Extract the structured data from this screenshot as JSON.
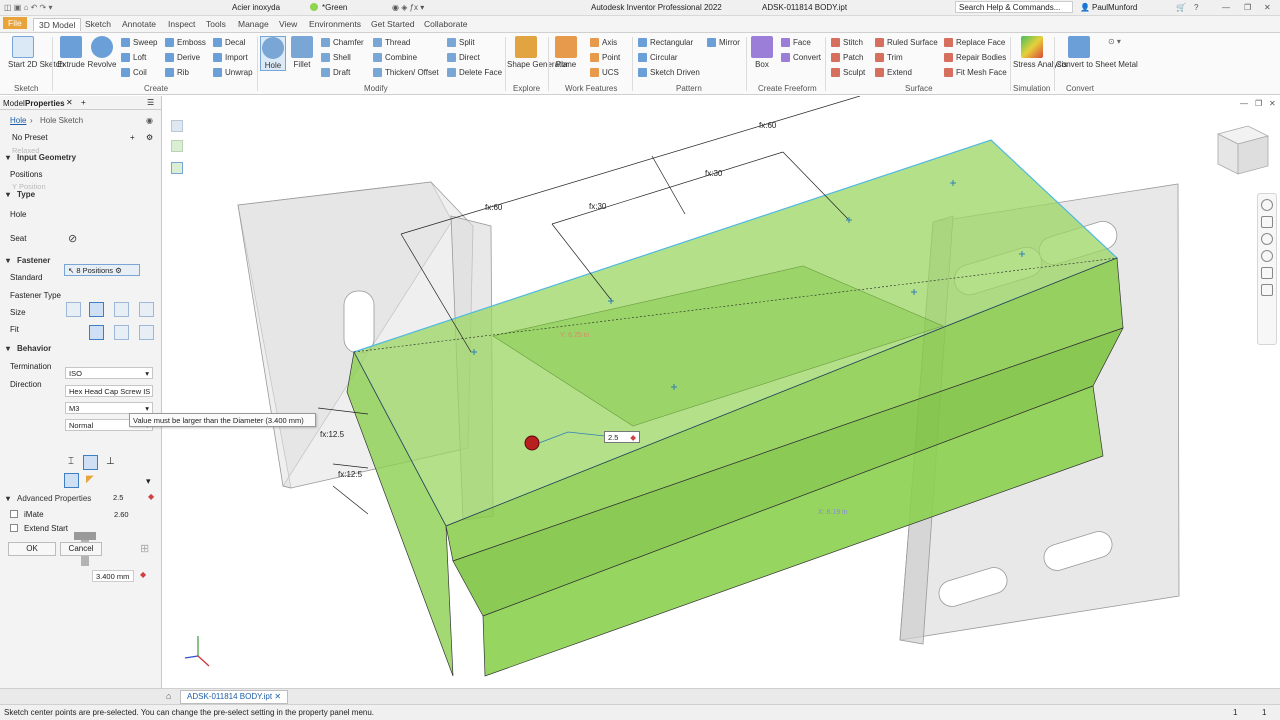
{
  "titlebar": {
    "material": "Acier inoxyda",
    "appearance": "*Green",
    "app_title": "Autodesk Inventor Professional 2022",
    "doc_title": "ADSK-011814 BODY.ipt",
    "search_placeholder": "Search Help & Commands...",
    "user": "PaulMunford"
  },
  "menu_tabs": [
    "File",
    "3D Model",
    "Sketch",
    "Annotate",
    "Inspect",
    "Tools",
    "Manage",
    "View",
    "Environments",
    "Get Started",
    "Collaborate"
  ],
  "ribbon": {
    "start_sketch": "Start 2D Sketch",
    "sketch_group": "Sketch",
    "extrude": "Extrude",
    "revolve": "Revolve",
    "sweep": "Sweep",
    "loft": "Loft",
    "coil": "Coil",
    "emboss": "Emboss",
    "derive": "Derive",
    "rib": "Rib",
    "decal": "Decal",
    "import": "Import",
    "unwrap": "Unwrap",
    "create_group": "Create",
    "hole": "Hole",
    "fillet": "Fillet",
    "chamfer": "Chamfer",
    "shell": "Shell",
    "draft": "Draft",
    "thread": "Thread",
    "combine": "Combine",
    "thicken": "Thicken/ Offset",
    "split": "Split",
    "direct": "Direct",
    "delete_face": "Delete Face",
    "modify_group": "Modify",
    "shape_gen": "Shape Generator",
    "explore_group": "Explore",
    "plane": "Plane",
    "axis": "Axis",
    "point": "Point",
    "ucs": "UCS",
    "work_group": "Work Features",
    "rectangular": "Rectangular",
    "circular": "Circular",
    "sketch_driven": "Sketch Driven",
    "mirror": "Mirror",
    "pattern_group": "Pattern",
    "box": "Box",
    "face": "Face",
    "convert": "Convert",
    "freeform_group": "Create Freeform",
    "stitch": "Stitch",
    "patch": "Patch",
    "sculpt": "Sculpt",
    "ruled_surface": "Ruled Surface",
    "trim": "Trim",
    "extend": "Extend",
    "replace_face": "Replace Face",
    "repair_bodies": "Repair Bodies",
    "fit_mesh_face": "Fit Mesh Face",
    "surface_group": "Surface",
    "stress": "Stress Analysis",
    "simulation_group": "Simulation",
    "convert_sheet": "Convert to Sheet Metal",
    "convert_group": "Convert"
  },
  "panel": {
    "tab_model": "Model",
    "tab_properties": "Properties",
    "breadcrumb_hole": "Hole",
    "breadcrumb_sketch": "Hole Sketch",
    "preset": "No Preset",
    "input_geometry": "Input Geometry",
    "positions_label": "Positions",
    "positions_value": "8 Positions",
    "type_header": "Type",
    "hole_label": "Hole",
    "seat_label": "Seat",
    "fastener_header": "Fastener",
    "standard_label": "Standard",
    "standard_value": "ISO",
    "fastener_type_label": "Fastener Type",
    "fastener_type_value": "Hex Head Cap Screw IS",
    "size_label": "Size",
    "size_value": "M3",
    "fit_label": "Fit",
    "fit_value": "Normal",
    "behavior_header": "Behavior",
    "termination_label": "Termination",
    "direction_label": "Direction",
    "dim_value": "2.5",
    "dim_small": "2.60",
    "dim_dia": "3.400 mm",
    "advanced": "Advanced Properties",
    "imate": "iMate",
    "extend_start": "Extend Start",
    "ok": "OK",
    "cancel": "Cancel"
  },
  "viewport": {
    "tooltip": "Value must be larger than the Diameter (3.400 mm)",
    "dim_input": "2.5",
    "dims": [
      "fx:60",
      "fx:60",
      "fx:30",
      "fx:30",
      "fx:12.5",
      "fx:12.5"
    ],
    "ghost_dims": [
      "Y: 6.25 in",
      "X: 8.19 in"
    ]
  },
  "document_tab": "ADSK-011814 BODY.ipt",
  "status": {
    "message": "Sketch center points are pre-selected. You can change the pre-select setting in the property panel menu.",
    "n1": "1",
    "n2": "1"
  },
  "colors": {
    "accent_orange": "#e8a33a",
    "selection_green": "#8ed44f",
    "edge_blue": "#4fb8e0",
    "ribbon_blue": "#3f7fc1"
  }
}
